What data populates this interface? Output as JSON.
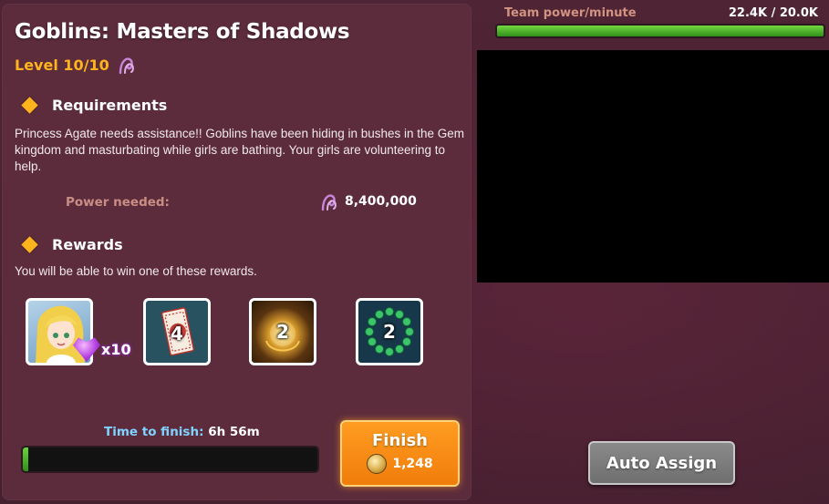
{
  "mission": {
    "title": "Goblins: Masters of Shadows",
    "level": "Level 10/10",
    "requirements_heading": "Requirements",
    "description": "Princess Agate needs assistance!! Goblins have been hiding in bushes in the Gem kingdom and masturbating while girls are bathing. Your girls are volunteering to help.",
    "power_needed_label": "Power needed:",
    "power_needed_value": "8,400,000",
    "rewards_heading": "Rewards",
    "rewards_subtitle": "You will be able to win one of these rewards.",
    "rewards": [
      {
        "icon": "girl-portrait",
        "badge": "x10"
      },
      {
        "icon": "ticket-icon",
        "count": "4"
      },
      {
        "icon": "orb-icon",
        "count": "2"
      },
      {
        "icon": "green-gem-ring-icon",
        "count": "2"
      }
    ],
    "time_label": "Time to finish:",
    "time_value": "6h 56m",
    "progress_fraction": 0.02,
    "finish_button": {
      "label": "Finish",
      "cost": "1,248"
    }
  },
  "team": {
    "label": "Team power/minute",
    "value": "22.4K / 20.0K",
    "progress_fraction": 1.0
  },
  "auto_assign_label": "Auto Assign",
  "colors": {
    "accent_gold": "#ffb41e",
    "finish_orange": "#f07d0a",
    "progress_green": "#4cc52b"
  }
}
